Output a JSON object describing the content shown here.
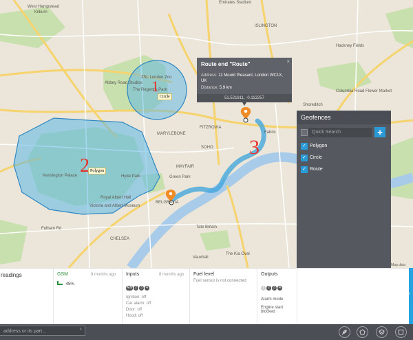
{
  "map": {
    "labels": {
      "west_hampstead": "West Hampstead",
      "kilburn": "Kilburn",
      "emirates": "Emirates Stadium",
      "islington": "ISLINGTON",
      "hackney": "Hackney Fields",
      "abbey_road": "Abbey Road Studios",
      "regents_park": "The Regent's Park",
      "zsl": "ZSL London Zoo",
      "marylebone": "MARYLEBONE",
      "fitzrovia": "FITZROVIA",
      "soho": "SOHO",
      "mayfair": "MAYFAIR",
      "kensington_palace": "Kensington Palace",
      "hyde_park": "Hyde Park",
      "royal_albert_hall": "Royal Albert Hall",
      "va": "Victoria and Albert Museum",
      "green_park": "Green Park",
      "belgravia": "BELGRAVIA",
      "tate": "Tate Britain",
      "shoreditch": "Shoreditch",
      "fabric": "Fabric",
      "columbia": "Columbia Road Flower Market",
      "kia_oval": "The Kia Oval",
      "chelsea": "CHELSEA",
      "fulham": "Fulham Rd",
      "vauxhall": "Vauxhall",
      "map_data": "Map data"
    },
    "geofences": {
      "circle": {
        "number": "1",
        "tag": "Circle",
        "color": "#5bb6e6"
      },
      "polygon": {
        "number": "2",
        "tag": "Polygon",
        "color": "#5bb6e6"
      },
      "route": {
        "number": "3",
        "color": "#3aa3dc"
      }
    },
    "number_color": "#e8312a"
  },
  "popup": {
    "title": "Route end \"Route\"",
    "address_label": "Address:",
    "address_value": "11 Mount Pleasant, London WC1X, UK",
    "distance_label": "Distance:",
    "distance_value": "5.9 km",
    "coords": "51.521811, -0.113257",
    "close_icon": "×"
  },
  "geofence_panel": {
    "title": "Geofences",
    "search_placeholder": "Quick Search",
    "add_label": "+",
    "items": [
      {
        "label": "Polygon",
        "checked": true
      },
      {
        "label": "Circle",
        "checked": true
      },
      {
        "label": "Route",
        "checked": true
      }
    ]
  },
  "infobar": {
    "readings_title": "readings",
    "gsm": {
      "title": "GSM",
      "ago": "8 months ago",
      "value": "45%"
    },
    "inputs": {
      "title": "Inputs",
      "ago": "8 months ago",
      "pills": [
        "AIN",
        "2",
        "3",
        "4"
      ],
      "lines": [
        "Ignition: off",
        "Car alarm: off",
        "Door: off",
        "Hood: off"
      ]
    },
    "fuel": {
      "title": "Fuel level",
      "text": "Fuel sensor is not connected"
    },
    "outputs": {
      "title": "Outputs",
      "pills": [
        "1",
        "2",
        "3",
        "4"
      ],
      "lines": [
        "Alarm mode",
        "Engine start blocked"
      ]
    }
  },
  "toolbar": {
    "search_placeholder": "address or its part...",
    "search_arrow": "›",
    "buttons": [
      "feather-icon",
      "pentagon-icon",
      "layers-icon",
      "fullscreen-icon"
    ]
  }
}
